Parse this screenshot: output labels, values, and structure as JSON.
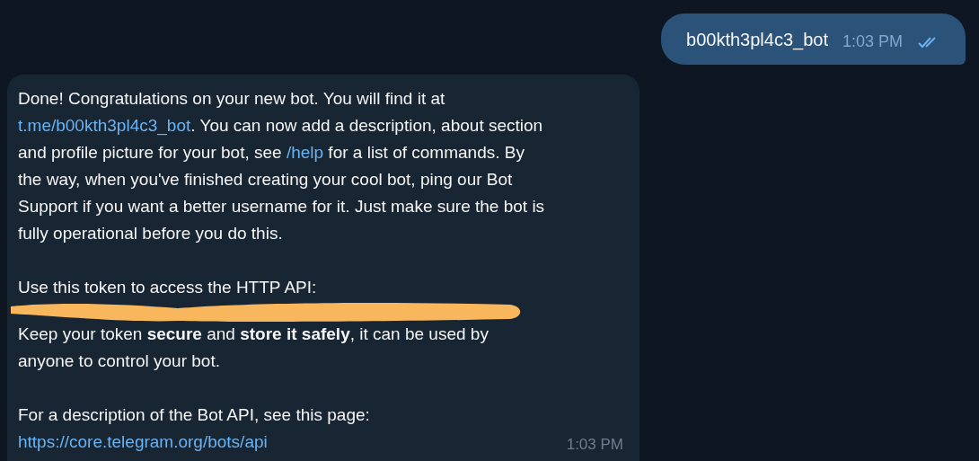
{
  "outgoing": {
    "text": "b00kth3pl4c3_bot",
    "time": "1:03 PM",
    "read": true
  },
  "incoming": {
    "time": "1:03 PM",
    "blocks": [
      {
        "kind": "paragraph",
        "segments": [
          {
            "kind": "text",
            "text": "Done! Congratulations on your new bot. You will find it at "
          },
          {
            "kind": "link",
            "text": "t.me/b00kth3pl4c3_bot"
          },
          {
            "kind": "text",
            "text": ". You can now add a description, about section and profile picture for your bot, see "
          },
          {
            "kind": "link",
            "text": "/help"
          },
          {
            "kind": "text",
            "text": " for a list of commands. By the way, when you've finished creating your cool bot, ping our Bot Support if you want a better username for it. Just make sure the bot is fully operational before you do this."
          }
        ]
      },
      {
        "kind": "paragraph",
        "segments": [
          {
            "kind": "text",
            "text": "Use this token to access the HTTP API:"
          }
        ]
      },
      {
        "kind": "redaction"
      },
      {
        "kind": "paragraph",
        "segments": [
          {
            "kind": "text",
            "text": "Keep your token **secure** and **store it safely**, it can be used by anyone to control your bot."
          }
        ]
      },
      {
        "kind": "paragraph",
        "segments": [
          {
            "kind": "text",
            "text": "For a description of the Bot API, see this page:"
          },
          {
            "kind": "break"
          },
          {
            "kind": "link",
            "text": "https://core.telegram.org/bots/api"
          }
        ]
      }
    ]
  }
}
